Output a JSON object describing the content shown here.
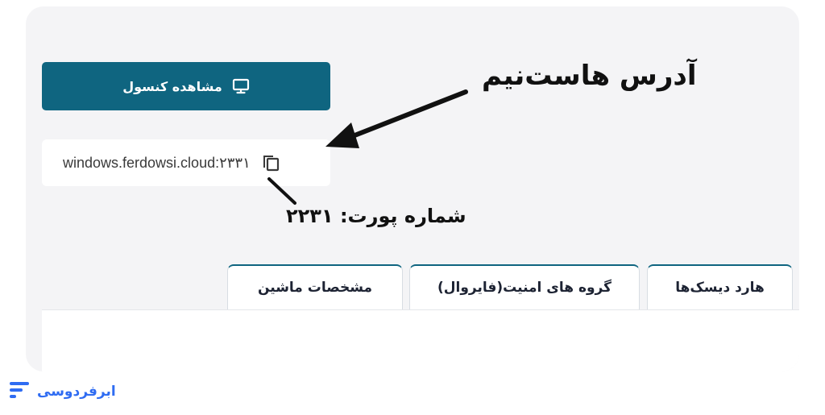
{
  "console_button": {
    "label": "مشاهده کنسول",
    "icon": "monitor-icon"
  },
  "host": {
    "address": "windows.ferdowsi.cloud:۲۳۳۱",
    "copy_icon": "copy-icon"
  },
  "annotations": {
    "host_label": "آدرس هاست‌نیم",
    "port_label": "شماره پورت: ۲۲۳۱"
  },
  "tabs": [
    {
      "label": "مشخصات ماشین"
    },
    {
      "label": "گروه های امنیت(فایروال)"
    },
    {
      "label": "هارد دیسک‌ها"
    }
  ],
  "brand": {
    "name": "ابرفردوسی",
    "icon": "brand-lines-icon"
  },
  "colors": {
    "accent": "#0f6580",
    "brand": "#2f6cf2",
    "panel_bg": "#f4f4f6"
  }
}
